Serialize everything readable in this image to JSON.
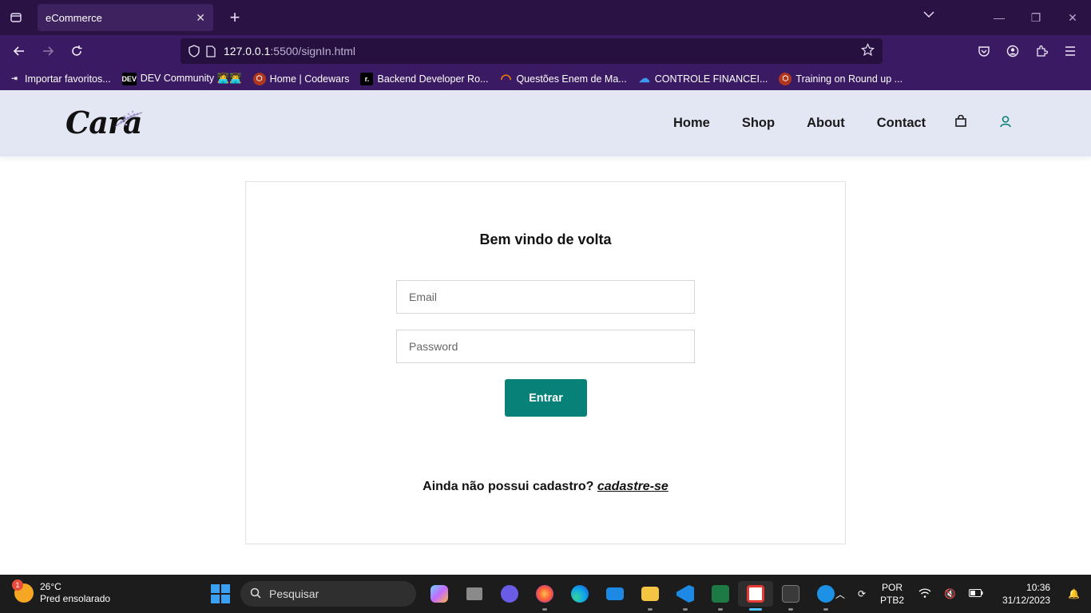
{
  "browser": {
    "tab_title": "eCommerce",
    "url_host": "127.0.0.1",
    "url_path": ":5500/signIn.html",
    "bookmarks": [
      {
        "label": "Importar favoritos...",
        "icon": "import-icon"
      },
      {
        "label": "DEV Community 👩‍💻👨‍💻",
        "icon": "dev-icon"
      },
      {
        "label": "Home | Codewars",
        "icon": "codewars-icon"
      },
      {
        "label": "Backend Developer Ro...",
        "icon": "roadmap-icon"
      },
      {
        "label": "Questões Enem de Ma...",
        "icon": "enem-icon"
      },
      {
        "label": "CONTROLE FINANCEI...",
        "icon": "onedrive-icon"
      },
      {
        "label": "Training on Round up ...",
        "icon": "codewars-icon"
      }
    ]
  },
  "site": {
    "logo_text": "Cara",
    "nav": {
      "home": "Home",
      "shop": "Shop",
      "about": "About",
      "contact": "Contact"
    },
    "accent_color": "#088178"
  },
  "login": {
    "title": "Bem vindo de volta",
    "email_placeholder": "Email",
    "password_placeholder": "Password",
    "submit_label": "Entrar",
    "signup_prompt": "Ainda não possui cadastro?",
    "signup_link": "cadastre-se"
  },
  "taskbar": {
    "weather_badge": "1",
    "temperature": "26°C",
    "weather_desc": "Pred ensolarado",
    "search_placeholder": "Pesquisar",
    "lang_line1": "POR",
    "lang_line2": "PTB2",
    "time": "10:36",
    "date": "31/12/2023"
  }
}
